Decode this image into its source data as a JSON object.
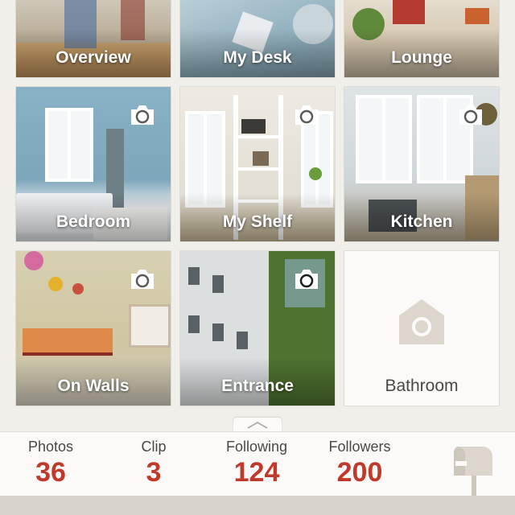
{
  "tiles": [
    {
      "label": "Overview",
      "camera": false
    },
    {
      "label": "My Desk",
      "camera": false
    },
    {
      "label": "Lounge",
      "camera": false
    },
    {
      "label": "Bedroom",
      "camera": true
    },
    {
      "label": "My Shelf",
      "camera": true
    },
    {
      "label": "Kitchen",
      "camera": true
    },
    {
      "label": "On Walls",
      "camera": true
    },
    {
      "label": "Entrance",
      "camera": true
    },
    {
      "label": "Bathroom",
      "camera": false,
      "empty": true,
      "icon": "house-camera-icon"
    }
  ],
  "stats": [
    {
      "label": "Photos",
      "value": "36"
    },
    {
      "label": "Clip",
      "value": "3"
    },
    {
      "label": "Following",
      "value": "124"
    },
    {
      "label": "Followers",
      "value": "200"
    }
  ],
  "icons": {
    "camera": "camera-icon",
    "mailbox": "mailbox-icon",
    "handle": "chevron-up-icon"
  },
  "colors": {
    "accent": "#c0392b",
    "background": "#f1efea",
    "tile_empty": "#fbfaf8"
  }
}
